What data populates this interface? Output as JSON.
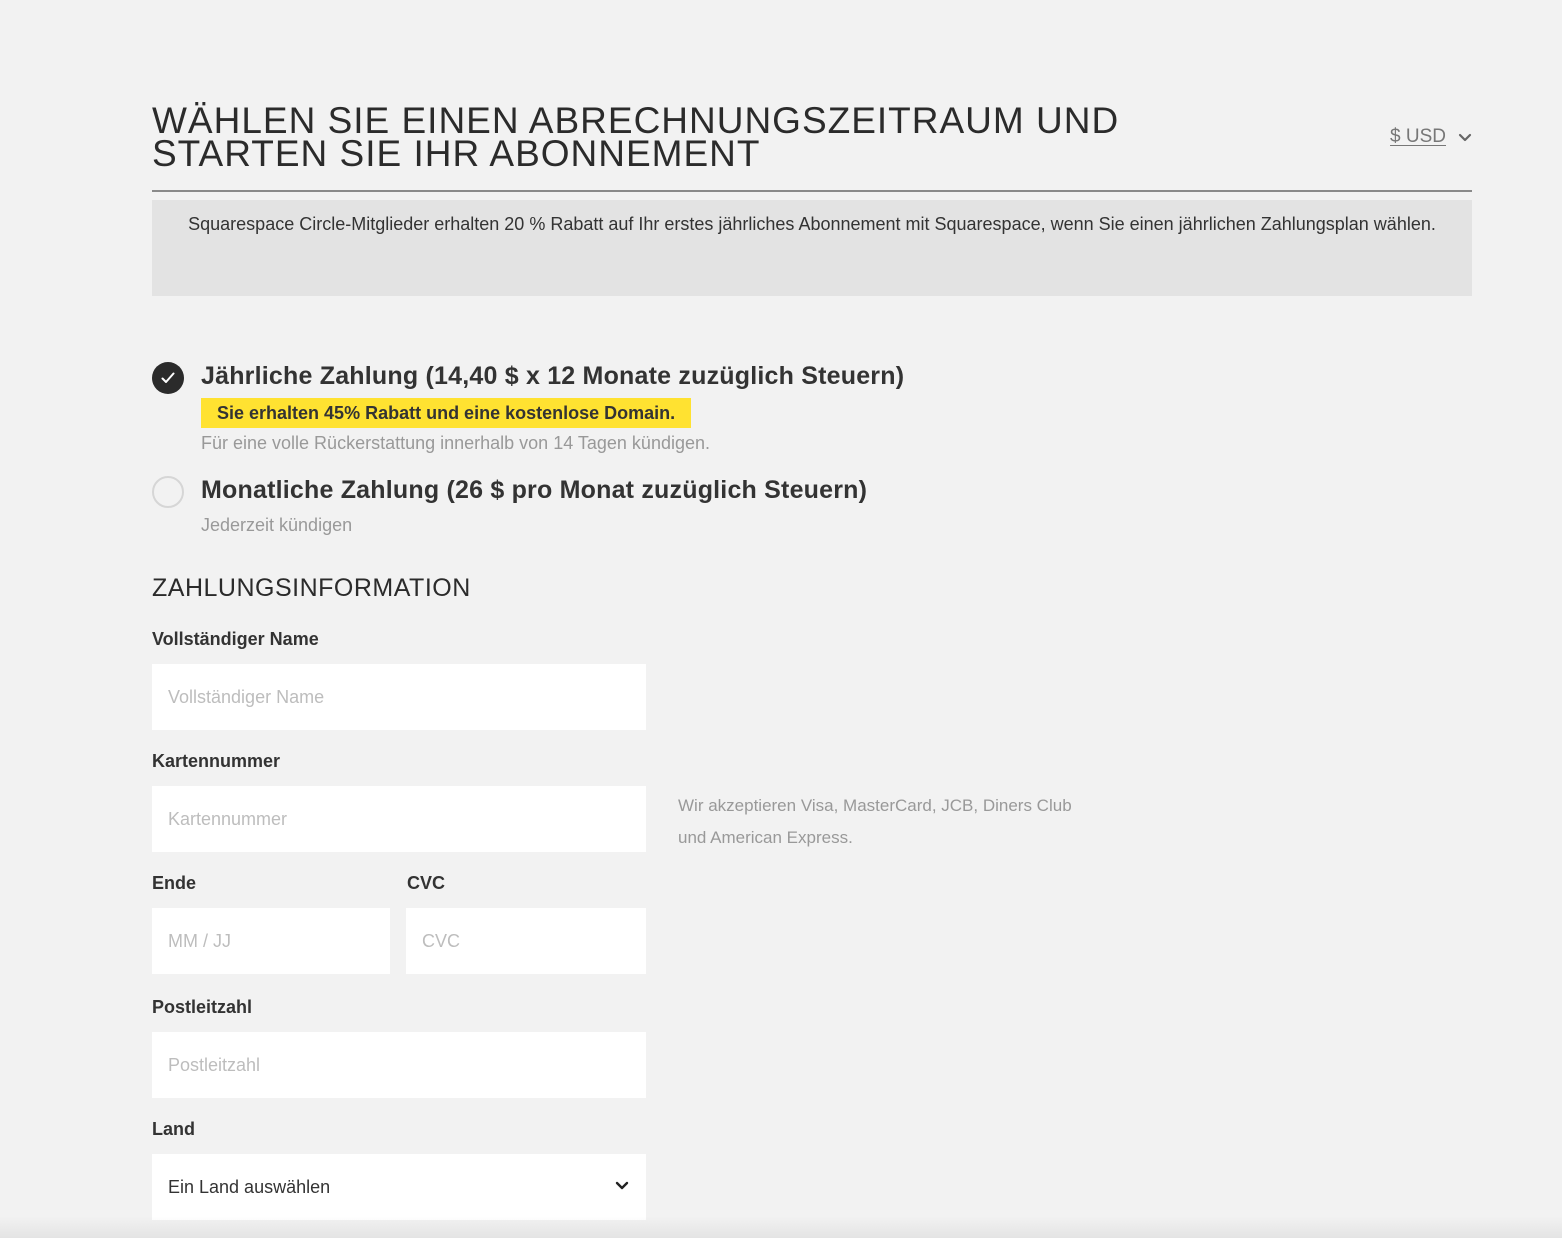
{
  "header": {
    "title": "WÄHLEN SIE EINEN ABRECHNUNGSZEITRAUM UND STARTEN SIE IHR ABONNEMENT",
    "currency": "$ USD",
    "currency_icon": "chevron-down-icon"
  },
  "promo": {
    "text": "Squarespace Circle-Mitglieder erhalten 20 % Rabatt auf Ihr erstes jährliches Abonnement mit Squarespace, wenn Sie einen jährlichen Zahlungsplan wählen."
  },
  "billing": {
    "annual": {
      "title": "Jährliche Zahlung (14,40 $ x 12 Monate zuzüglich Steuern)",
      "highlight": "Sie erhalten 45% Rabatt und eine kostenlose Domain.",
      "note": "Für eine volle Rückerstattung innerhalb von 14 Tagen kündigen.",
      "selected": true
    },
    "monthly": {
      "title": "Monatliche Zahlung (26 $ pro Monat zuzüglich Steuern)",
      "note": "Jederzeit kündigen",
      "selected": false
    },
    "highlight_color": "#ffe231"
  },
  "payment": {
    "section_title": "ZAHLUNGSINFORMATION",
    "full_name": {
      "label": "Vollständiger Name",
      "placeholder": "Vollständiger Name",
      "value": ""
    },
    "card_number": {
      "label": "Kartennummer",
      "placeholder": "Kartennummer",
      "value": "",
      "help": "Wir akzeptieren Visa, MasterCard, JCB, Diners Club und American Express."
    },
    "expiry": {
      "label": "Ende",
      "placeholder": "MM / JJ",
      "value": ""
    },
    "cvc": {
      "label": "CVC",
      "placeholder": "CVC",
      "value": ""
    },
    "postal_code": {
      "label": "Postleitzahl",
      "placeholder": "Postleitzahl",
      "value": ""
    },
    "country": {
      "label": "Land",
      "selected": "Ein Land auswählen",
      "icon": "chevron-down-icon"
    }
  }
}
